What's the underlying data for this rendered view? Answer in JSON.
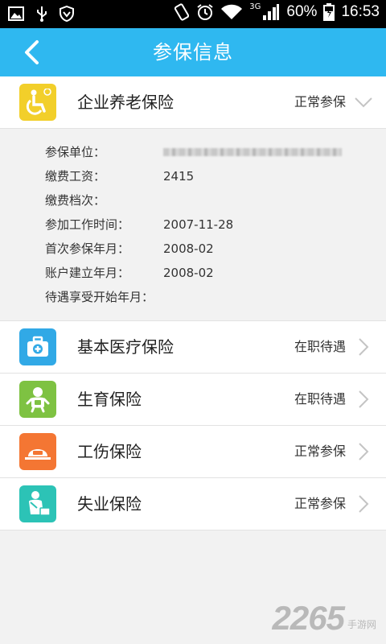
{
  "status_bar": {
    "icons_left": [
      "image-icon",
      "usb-icon",
      "shield-icon"
    ],
    "icons_right": [
      "vibrate-icon",
      "alarm-icon",
      "wifi-icon",
      "signal-icon",
      "battery-icon"
    ],
    "network_type": "3G",
    "battery": "60%",
    "time": "16:53"
  },
  "header": {
    "title": "参保信息",
    "back_icon": "chevron-left-icon"
  },
  "insurances": [
    {
      "name": "企业养老保险",
      "status": "正常参保",
      "icon": "pension-icon",
      "icon_color": "#f2cf2a",
      "expanded": true,
      "details": [
        {
          "label": "参保单位：",
          "value": ""
        },
        {
          "label": "缴费工资：",
          "value": "2415"
        },
        {
          "label": "缴费档次：",
          "value": ""
        },
        {
          "label": "参加工作时间：",
          "value": "2007-11-28"
        },
        {
          "label": "首次参保年月：",
          "value": "2008-02"
        },
        {
          "label": "账户建立年月：",
          "value": "2008-02"
        },
        {
          "label": "待遇享受开始年月：",
          "value": ""
        }
      ]
    },
    {
      "name": "基本医疗保险",
      "status": "在职待遇",
      "icon": "medical-kit-icon",
      "icon_color": "#31a9e6"
    },
    {
      "name": "生育保险",
      "status": "在职待遇",
      "icon": "baby-icon",
      "icon_color": "#7ec242"
    },
    {
      "name": "工伤保险",
      "status": "正常参保",
      "icon": "helmet-icon",
      "icon_color": "#f47633"
    },
    {
      "name": "失业保险",
      "status": "正常参保",
      "icon": "unemployed-person-icon",
      "icon_color": "#2cc3b6"
    }
  ],
  "watermark": {
    "logo": "2265",
    "sub": "手游网"
  },
  "colors": {
    "accent": "#2fb8f0",
    "background": "#f2f2f2"
  }
}
